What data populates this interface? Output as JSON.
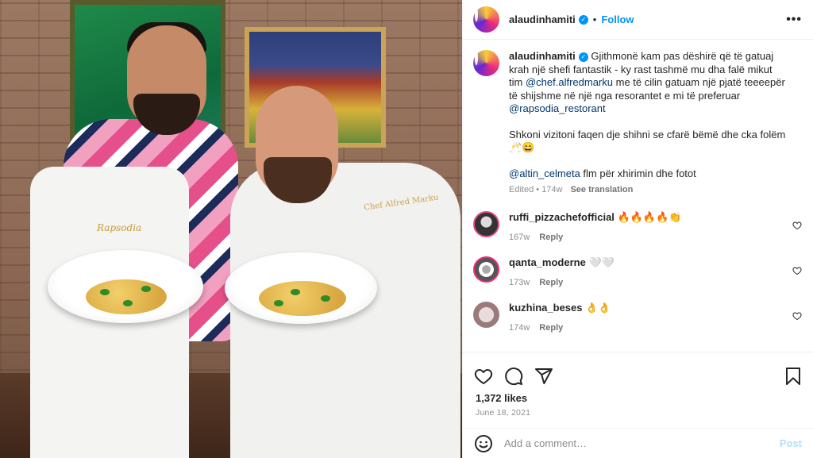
{
  "header": {
    "username": "alaudinhamiti",
    "separator": "•",
    "follow_label": "Follow",
    "more_label": "•••"
  },
  "caption": {
    "username": "alaudinhamiti",
    "text_1": "Gjithmonë kam pas dëshirë që të gatuaj krah një shefi fantastik - ky rast tashmë mu dha falë mikut tim",
    "mention_1": "@chef.alfredmarku",
    "text_2": "me të cilin gatuam një pjatë teeeepër të shijshme në një nga resorantet e mi të preferuar",
    "mention_2": "@rapsodia_restorant",
    "paragraph_2": "Shkoni vizitoni faqen dje shihni se cfarë bëmë dhe cka folëm 🥂😄",
    "mention_3": "@altin_celmeta",
    "paragraph_3_rest": "flm për xhirimin dhe fotot",
    "time": "Edited • 174w",
    "translation_label": "See translation"
  },
  "comments": [
    {
      "username": "ruffi_pizzachefofficial",
      "text": "🔥🔥🔥🔥👏",
      "time": "167w",
      "reply": "Reply"
    },
    {
      "username": "qanta_moderne",
      "text": "🤍🤍",
      "time": "173w",
      "reply": "Reply"
    },
    {
      "username": "kuzhina_beses",
      "text": "👌👌",
      "time": "174w",
      "reply": "Reply"
    }
  ],
  "actions": {
    "likes": "1,372 likes",
    "date": "June 18, 2021"
  },
  "add_comment": {
    "placeholder": "Add a comment…",
    "post_label": "Post"
  },
  "photo": {
    "apron_logo": "Rapsodia",
    "chef_badge": "Chef Alfred Marku"
  },
  "colors": {
    "link_blue": "#0095f6",
    "mention_blue": "#00376b",
    "muted": "#8e8e8e"
  },
  "icons": [
    "verified-icon",
    "more-icon",
    "heart-icon",
    "comment-icon",
    "share-icon",
    "bookmark-icon",
    "emoji-icon"
  ]
}
